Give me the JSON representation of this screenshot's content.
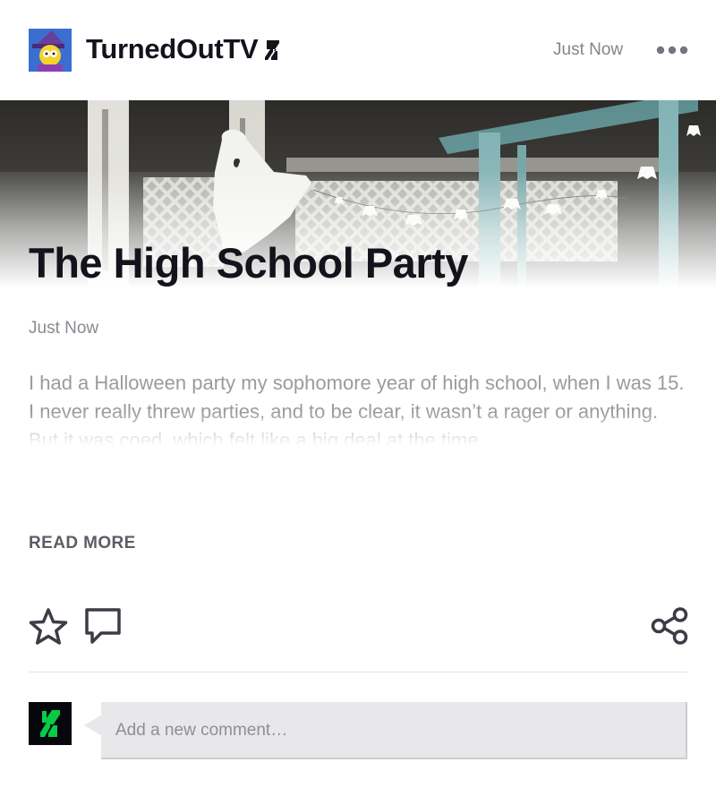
{
  "header": {
    "username": "TurnedOutTV",
    "timestamp": "Just Now",
    "badge_icon": "deviantart-badge-icon",
    "more_icon": "more-dots-icon"
  },
  "post": {
    "title": "The High School Party",
    "timestamp": "Just Now",
    "excerpt": "I had a Halloween party my sophomore year of high school, when I was 15. I never really threw parties, and to be clear, it wasn’t a rager or anything. But it was coed, which felt like a big deal at the time.",
    "read_more": "READ MORE"
  },
  "actions": {
    "favorite_icon": "star-icon",
    "comment_icon": "comment-icon",
    "share_icon": "share-icon"
  },
  "comment": {
    "placeholder": "Add a new comment…"
  },
  "colors": {
    "brand_green": "#05cc47",
    "title_text": "#14131c",
    "muted_text": "#8a8a91"
  }
}
